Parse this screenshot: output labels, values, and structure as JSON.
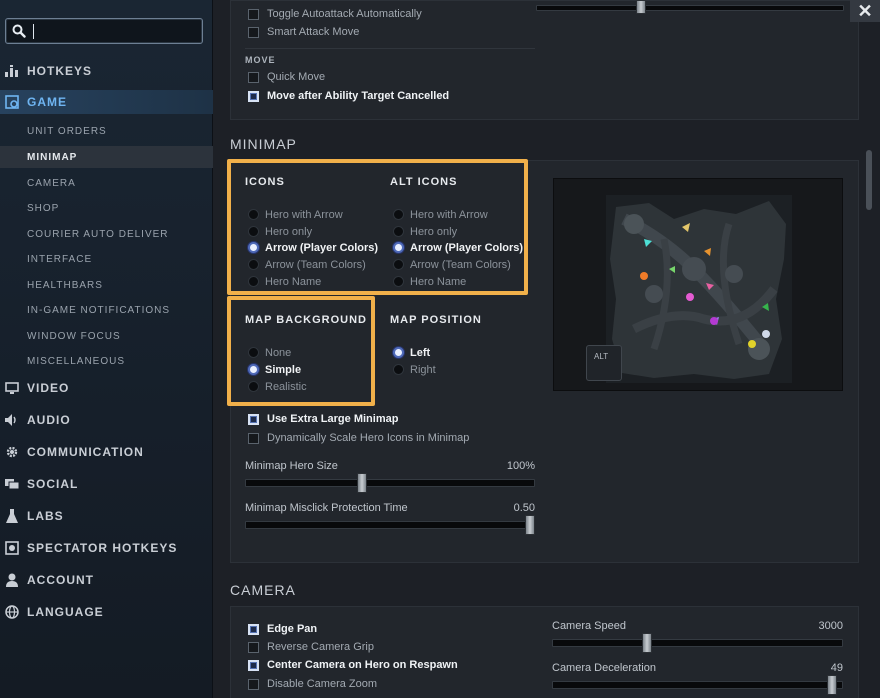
{
  "search": {
    "value": "",
    "placeholder": ""
  },
  "sidebar": {
    "top_items": [
      {
        "label": "HOTKEYS",
        "icon": "hotkeys-icon"
      },
      {
        "label": "GAME",
        "icon": "game-icon"
      }
    ],
    "sub_items": [
      "UNIT ORDERS",
      "MINIMAP",
      "CAMERA",
      "SHOP",
      "COURIER AUTO DELIVER",
      "INTERFACE",
      "HEALTHBARS",
      "IN-GAME NOTIFICATIONS",
      "WINDOW FOCUS",
      "MISCELLANEOUS"
    ],
    "bottom_items": [
      {
        "label": "VIDEO",
        "icon": "monitor-icon"
      },
      {
        "label": "AUDIO",
        "icon": "speaker-icon"
      },
      {
        "label": "COMMUNICATION",
        "icon": "gear-icon"
      },
      {
        "label": "SOCIAL",
        "icon": "chat-icon"
      },
      {
        "label": "LABS",
        "icon": "flask-icon"
      },
      {
        "label": "SPECTATOR HOTKEYS",
        "icon": "camera-icon"
      },
      {
        "label": "ACCOUNT",
        "icon": "user-icon"
      },
      {
        "label": "LANGUAGE",
        "icon": "globe-icon"
      }
    ]
  },
  "unit_orders": {
    "toggle_autoattack": "Toggle Autoattack Automatically",
    "smart_attack_move": "Smart Attack Move",
    "move_title": "MOVE",
    "quick_move": "Quick Move",
    "move_after_ability": "Move after Ability Target Cancelled"
  },
  "minimap": {
    "title": "MINIMAP",
    "icons_title": "ICONS",
    "alt_icons_title": "ALT ICONS",
    "icon_options": [
      "Hero with Arrow",
      "Hero only",
      "Arrow (Player Colors)",
      "Arrow (Team Colors)",
      "Hero Name"
    ],
    "selected_icon": "Arrow (Player Colors)",
    "selected_alt_icon": "Arrow (Player Colors)",
    "background_title": "MAP BACKGROUND",
    "background_options": [
      "None",
      "Simple",
      "Realistic"
    ],
    "selected_background": "Simple",
    "position_title": "MAP POSITION",
    "position_options": [
      "Left",
      "Right"
    ],
    "selected_position": "Left",
    "extra_large": "Use Extra Large Minimap",
    "dynamic_scale": "Dynamically Scale Hero Icons in Minimap",
    "hero_size_label": "Minimap Hero Size",
    "hero_size_value": "100%",
    "hero_size_fraction": 0.4,
    "misclick_label": "Minimap Misclick Protection Time",
    "misclick_value": "0.50",
    "misclick_fraction": 1.0,
    "alt_label": "ALT"
  },
  "camera": {
    "title": "CAMERA",
    "edge_pan": "Edge Pan",
    "reverse_grip": "Reverse Camera Grip",
    "center_on_respawn": "Center Camera on Hero on Respawn",
    "disable_zoom": "Disable Camera Zoom",
    "speed_label": "Camera Speed",
    "speed_value": "3000",
    "speed_fraction": 0.32,
    "decel_label": "Camera Deceleration",
    "decel_value": "49",
    "decel_fraction": 0.98
  },
  "colors": {
    "accent": "#6fb5f2",
    "highlight": "#f1b04a"
  }
}
